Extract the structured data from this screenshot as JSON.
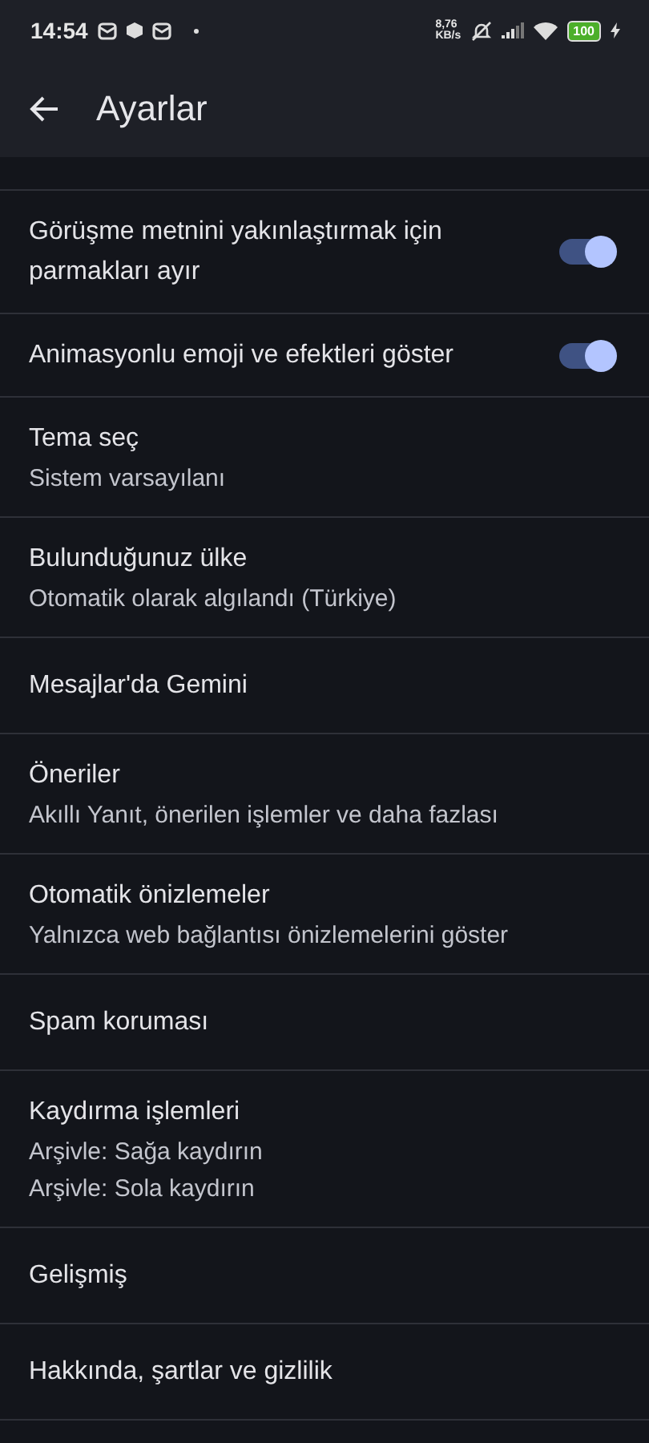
{
  "status_bar": {
    "time": "14:54",
    "net_speed": "8,76",
    "net_unit": "KB/s",
    "battery": "100"
  },
  "header": {
    "title": "Ayarlar"
  },
  "settings": [
    {
      "kind": "toggle",
      "title": "Görüşme metnini yakınlaştırmak için parmakları ayır",
      "on": true
    },
    {
      "kind": "toggle",
      "title": "Animasyonlu emoji ve efektleri göster",
      "on": true
    },
    {
      "kind": "item",
      "title": "Tema seç",
      "subtitles": [
        "Sistem varsayılanı"
      ]
    },
    {
      "kind": "item",
      "title": "Bulunduğunuz ülke",
      "subtitles": [
        "Otomatik olarak algılandı (Türkiye)"
      ]
    },
    {
      "kind": "item",
      "title": "Mesajlar'da Gemini"
    },
    {
      "kind": "item",
      "title": "Öneriler",
      "subtitles": [
        "Akıllı Yanıt, önerilen işlemler ve daha fazlası"
      ]
    },
    {
      "kind": "item",
      "title": "Otomatik önizlemeler",
      "subtitles": [
        "Yalnızca web bağlantısı önizlemelerini göster"
      ]
    },
    {
      "kind": "item",
      "title": "Spam koruması"
    },
    {
      "kind": "item",
      "title": "Kaydırma işlemleri",
      "subtitles": [
        "Arşivle: Sağa kaydırın",
        "Arşivle: Sola kaydırın"
      ]
    },
    {
      "kind": "item",
      "title": "Gelişmiş"
    },
    {
      "kind": "item",
      "title": "Hakkında, şartlar ve gizlilik"
    }
  ]
}
